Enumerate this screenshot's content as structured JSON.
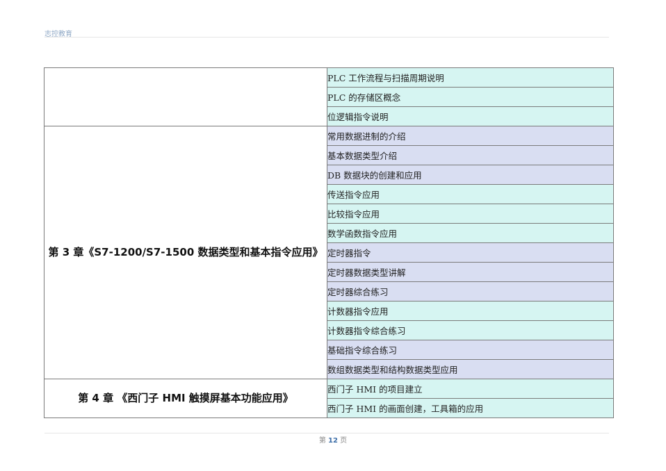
{
  "header": {
    "brand": "志控教育"
  },
  "table": {
    "groups": [
      {
        "chapter": "",
        "lessons": [
          {
            "text": "PLC 工作流程与扫描周期说明",
            "color": "cyan"
          },
          {
            "text": "PLC 的存储区概念",
            "color": "cyan"
          },
          {
            "text": "位逻辑指令说明",
            "color": "cyan"
          }
        ]
      },
      {
        "chapter": "第 3 章《S7-1200/S7-1500 数据类型和基本指令应用》",
        "lessons": [
          {
            "text": "常用数据进制的介绍",
            "color": "lav"
          },
          {
            "text": "基本数据类型介绍",
            "color": "lav"
          },
          {
            "text": "DB 数据块的创建和应用",
            "color": "lav"
          },
          {
            "text": "传送指令应用",
            "color": "cyan"
          },
          {
            "text": "比较指令应用",
            "color": "cyan"
          },
          {
            "text": "数学函数指令应用",
            "color": "cyan"
          },
          {
            "text": "定时器指令",
            "color": "lav"
          },
          {
            "text": "定时器数据类型讲解",
            "color": "lav"
          },
          {
            "text": "定时器综合练习",
            "color": "lav"
          },
          {
            "text": "计数器指令应用",
            "color": "cyan"
          },
          {
            "text": "计数器指令综合练习",
            "color": "cyan"
          },
          {
            "text": "基础指令综合练习",
            "color": "lav"
          },
          {
            "text": "数组数据类型和结构数据类型应用",
            "color": "lav"
          }
        ]
      },
      {
        "chapter": "第 4 章 《西门子 HMI 触摸屏基本功能应用》",
        "lessons": [
          {
            "text": "西门子 HMI 的项目建立",
            "color": "cyan"
          },
          {
            "text": "西门子 HMI 的画面创建，工具箱的应用",
            "color": "cyan"
          }
        ]
      }
    ]
  },
  "footer": {
    "prefix": "第",
    "page": "12",
    "suffix": "页"
  }
}
